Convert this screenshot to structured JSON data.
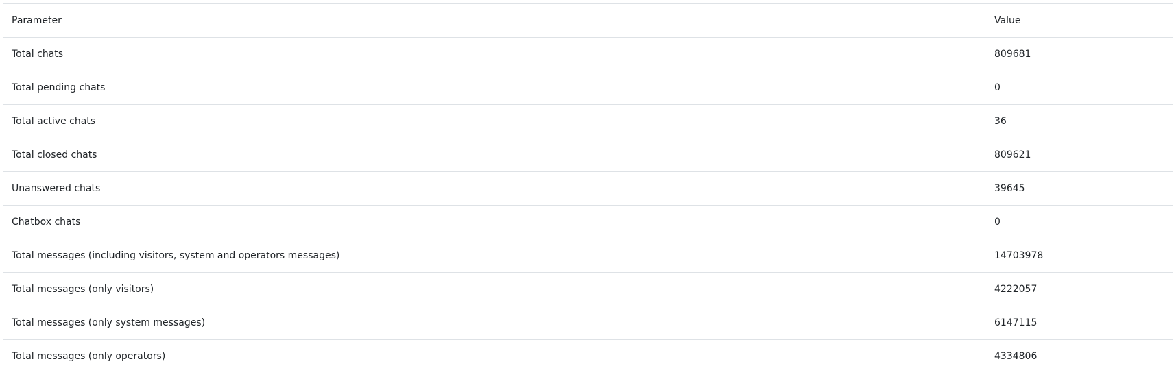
{
  "table": {
    "headers": {
      "parameter": "Parameter",
      "value": "Value"
    },
    "rows": [
      {
        "parameter": "Total chats",
        "value": "809681"
      },
      {
        "parameter": "Total pending chats",
        "value": "0"
      },
      {
        "parameter": "Total active chats",
        "value": "36"
      },
      {
        "parameter": "Total closed chats",
        "value": "809621"
      },
      {
        "parameter": "Unanswered chats",
        "value": "39645"
      },
      {
        "parameter": "Chatbox chats",
        "value": "0"
      },
      {
        "parameter": "Total messages (including visitors, system and operators messages)",
        "value": "14703978"
      },
      {
        "parameter": "Total messages (only visitors)",
        "value": "4222057"
      },
      {
        "parameter": "Total messages (only system messages)",
        "value": "6147115"
      },
      {
        "parameter": "Total messages (only operators)",
        "value": "4334806"
      }
    ]
  }
}
